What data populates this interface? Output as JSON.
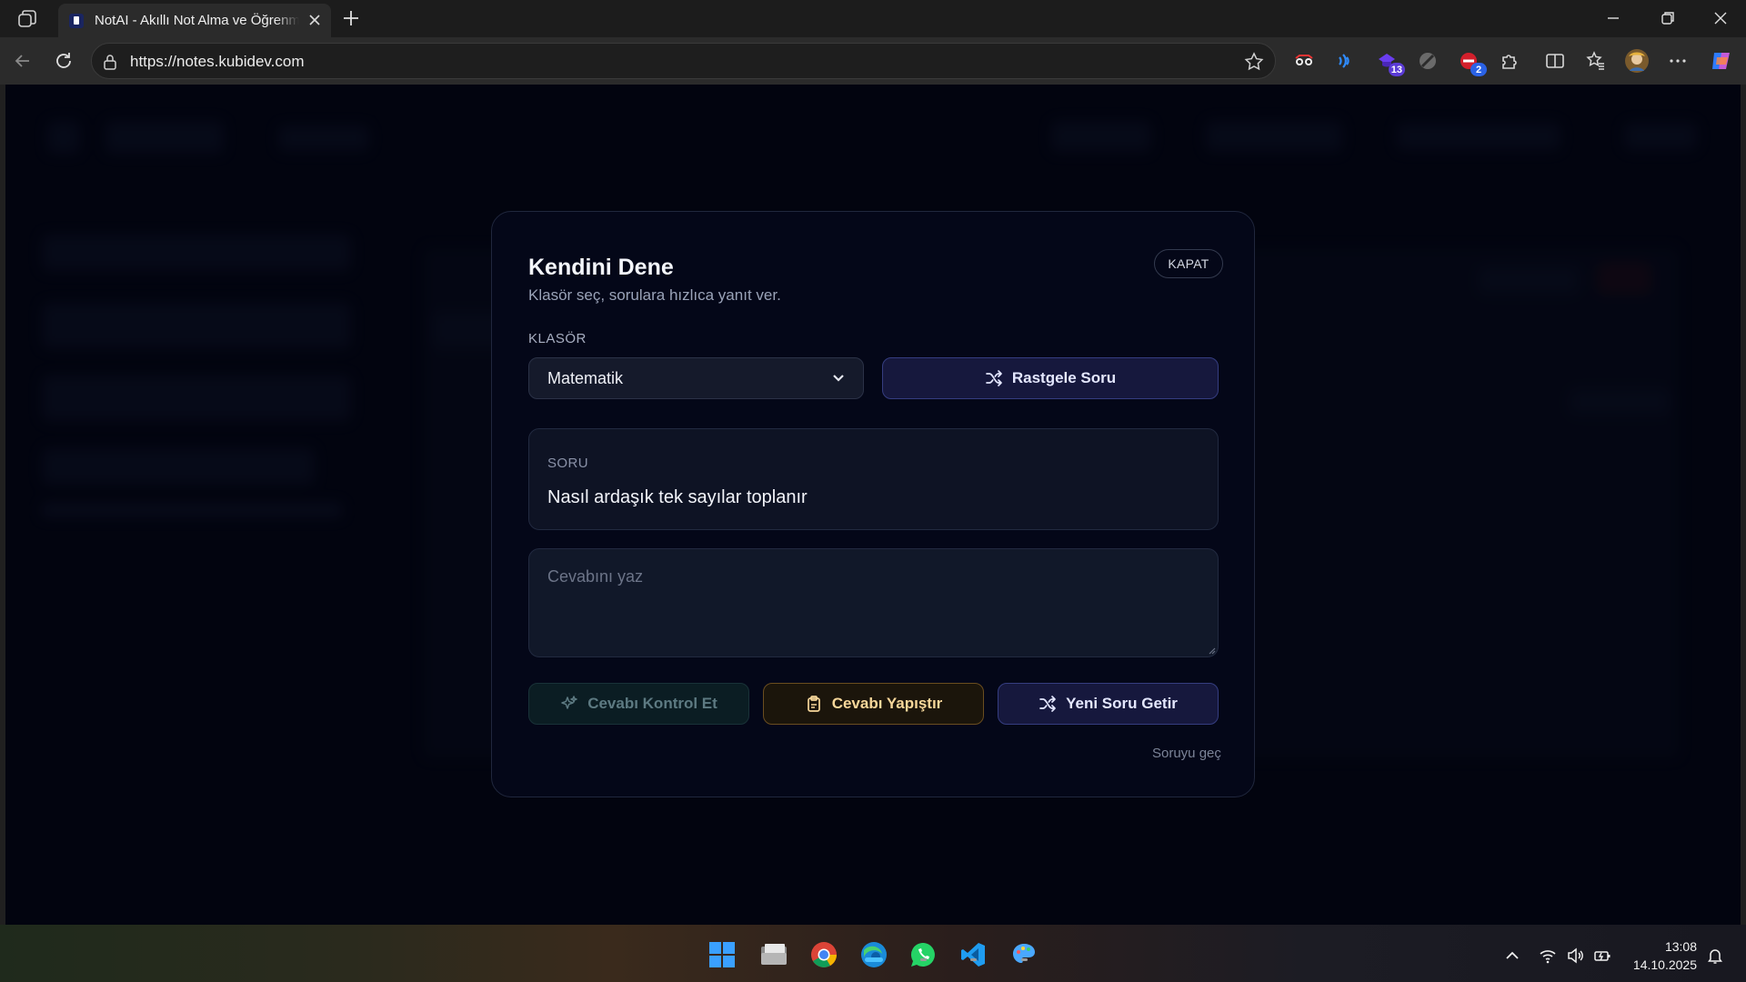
{
  "browser": {
    "tab_title": "NotAI - Akıllı Not Alma ve Öğrenme",
    "url": "https://notes.kubidev.com",
    "extensions": [
      {
        "icon": "glasses-extension-icon"
      },
      {
        "icon": "read-aloud-extension-icon"
      },
      {
        "icon": "tracker-extension-icon",
        "badge": "13",
        "badge_color": "#5b3bd6"
      },
      {
        "icon": "blocked-extension-icon"
      },
      {
        "icon": "adblock-extension-icon",
        "badge": "2",
        "badge_color": "#2a62e6"
      },
      {
        "icon": "puzzle-extensions-icon"
      },
      {
        "icon": "split-screen-icon"
      },
      {
        "icon": "favorites-icon"
      },
      {
        "icon": "profile-avatar-icon"
      },
      {
        "icon": "more-menu-icon"
      },
      {
        "icon": "copilot-icon"
      }
    ]
  },
  "modal": {
    "title": "Kendini Dene",
    "subtitle": "Klasör seç, sorulara hızlıca yanıt ver.",
    "close_label": "KAPAT",
    "folder_label": "KLASÖR",
    "folder_selected": "Matematik",
    "random_button": "Rastgele Soru",
    "question_label": "SORU",
    "question_text": "Nasıl ardaşık tek sayılar toplanır",
    "answer_placeholder": "Cevabını yaz",
    "check_button": "Cevabı Kontrol Et",
    "paste_button": "Cevabı Yapıştır",
    "new_question_button": "Yeni Soru Getir",
    "skip_link": "Soruyu geç"
  },
  "taskbar": {
    "apps": [
      "windows-start-icon",
      "file-explorer-icon",
      "chrome-icon",
      "edge-icon",
      "whatsapp-icon",
      "vscode-icon",
      "paint-icon"
    ],
    "time": "13:08",
    "date": "14.10.2025"
  },
  "colors": {
    "page_background": "#030513",
    "modal_background": "#040718",
    "accent_indigo": "#353d80",
    "accent_amber": "#f7d79a",
    "disabled_teal": "#5d7a82"
  }
}
